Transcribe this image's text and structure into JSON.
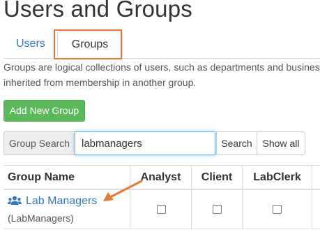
{
  "page": {
    "title": "Users and Groups"
  },
  "tabs": [
    {
      "label": "Users",
      "active": false
    },
    {
      "label": "Groups",
      "active": true
    }
  ],
  "description": "Groups are logical collections of users, such as departments and business units. Users can be inherited from membership in another group.",
  "description_visible": {
    "line1": "Groups are logical collections of users, such as departments and busines",
    "line2": "inherited from membership in another group."
  },
  "actions": {
    "add_group_label": "Add New Group"
  },
  "search": {
    "label": "Group Search",
    "value": "labmanagers",
    "search_button": "Search",
    "show_all_button": "Show all"
  },
  "table": {
    "columns": [
      "Group Name",
      "Analyst",
      "Client",
      "LabClerk"
    ],
    "rows": [
      {
        "name": "Lab Managers",
        "code": "(LabManagers)",
        "icon": "users-icon",
        "roles": {
          "Analyst": false,
          "Client": false,
          "LabClerk": false
        }
      }
    ]
  },
  "colors": {
    "accent_link": "#337ab7",
    "button_success": "#5cb85c",
    "annotation_orange": "#e07b39"
  }
}
